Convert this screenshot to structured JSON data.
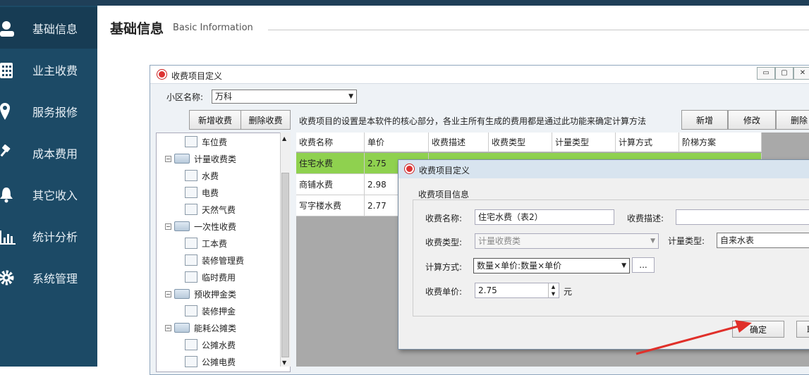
{
  "sidebar": {
    "items": [
      {
        "label": "基础信息",
        "icon": "user-icon"
      },
      {
        "label": "业主收费",
        "icon": "calculator-icon"
      },
      {
        "label": "服务报修",
        "icon": "location-pin-icon"
      },
      {
        "label": "成本费用",
        "icon": "gavel-icon"
      },
      {
        "label": "其它收入",
        "icon": "bell-icon"
      },
      {
        "label": "统计分析",
        "icon": "bar-chart-icon"
      },
      {
        "label": "系统管理",
        "icon": "gear-icon"
      }
    ]
  },
  "header": {
    "title": "基础信息",
    "subtitle": "Basic Information"
  },
  "window": {
    "title": "收费项目定义",
    "community_label": "小区名称:",
    "community_value": "万科",
    "buttons": {
      "add_fee": "新增收费",
      "delete_fee": "删除收费",
      "new": "新增",
      "edit": "修改",
      "delete": "删除"
    },
    "hint": "收费项目的设置是本软件的核心部分，各业主所有生成的费用都是通过此功能来确定计算方法",
    "tree": [
      "车位费",
      "计量收费类",
      "水费",
      "电费",
      "天然气费",
      "一次性收费",
      "工本费",
      "装修管理费",
      "临时费用",
      "预收押金类",
      "装修押金",
      "能耗公摊类",
      "公摊水费",
      "公摊电费"
    ],
    "columns": [
      "收费名称",
      "单价",
      "收费描述",
      "收费类型",
      "计量类型",
      "计算方式",
      "阶梯方案"
    ],
    "rows": [
      {
        "name": "住宅水费",
        "price": "2.75"
      },
      {
        "name": "商铺水费",
        "price": "2.98"
      },
      {
        "name": "写字楼水费",
        "price": "2.77"
      }
    ]
  },
  "dialog": {
    "title": "收费项目定义",
    "group": "收费项目信息",
    "name_label": "收费名称:",
    "name_value": "住宅水费（表2）",
    "desc_label": "收费描述:",
    "type_label": "收费类型:",
    "type_value": "计量收费类",
    "meter_label": "计量类型:",
    "meter_value": "自来水表",
    "calc_label": "计算方式:",
    "calc_value": "数量×单价:数量×单价",
    "dots": "...",
    "price_label": "收费单价:",
    "price_value": "2.75",
    "unit": "元",
    "ok": "确定",
    "cancel": "取"
  },
  "colors": {
    "sidebar": "#1c4a66",
    "selected_row": "#8fd14f",
    "arrow": "#e0302a"
  }
}
